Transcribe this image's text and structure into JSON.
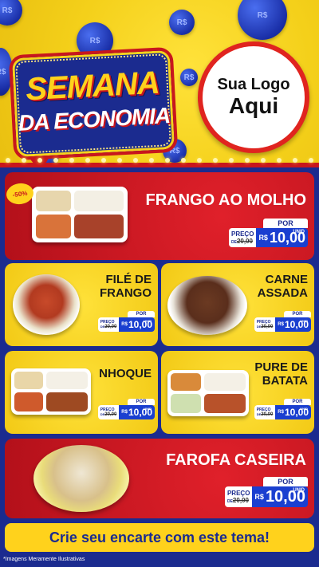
{
  "hero": {
    "title_line1": "SEMANA",
    "title_line2": "DA ECONOMIA",
    "logo_line1": "Sua Logo",
    "logo_line2": "Aqui",
    "coin_label": "R$"
  },
  "colors": {
    "brand_blue": "#1b2b8f",
    "brand_red": "#c8161d",
    "brand_yellow": "#ffd21c",
    "price_blue": "#1a3fd0"
  },
  "badge": "-50%",
  "price_labels": {
    "por": "POR",
    "preco": "PREÇO",
    "de": "DE",
    "old_value": "20,00",
    "currency": "R$",
    "new_value": "10,00",
    "unit": "UNID"
  },
  "products": [
    {
      "name": "FRANGO AO MOLHO"
    },
    {
      "name_line1": "FILÉ DE",
      "name_line2": "FRANGO"
    },
    {
      "name_line1": "CARNE",
      "name_line2": "ASSADA"
    },
    {
      "name": "NHOQUE"
    },
    {
      "name_line1": "PURE DE",
      "name_line2": "BATATA"
    },
    {
      "name": "FAROFA CASEIRA"
    }
  ],
  "cta": "Crie seu encarte com este tema!",
  "footer_note": "*Imagens Meramente Ilustrativas"
}
